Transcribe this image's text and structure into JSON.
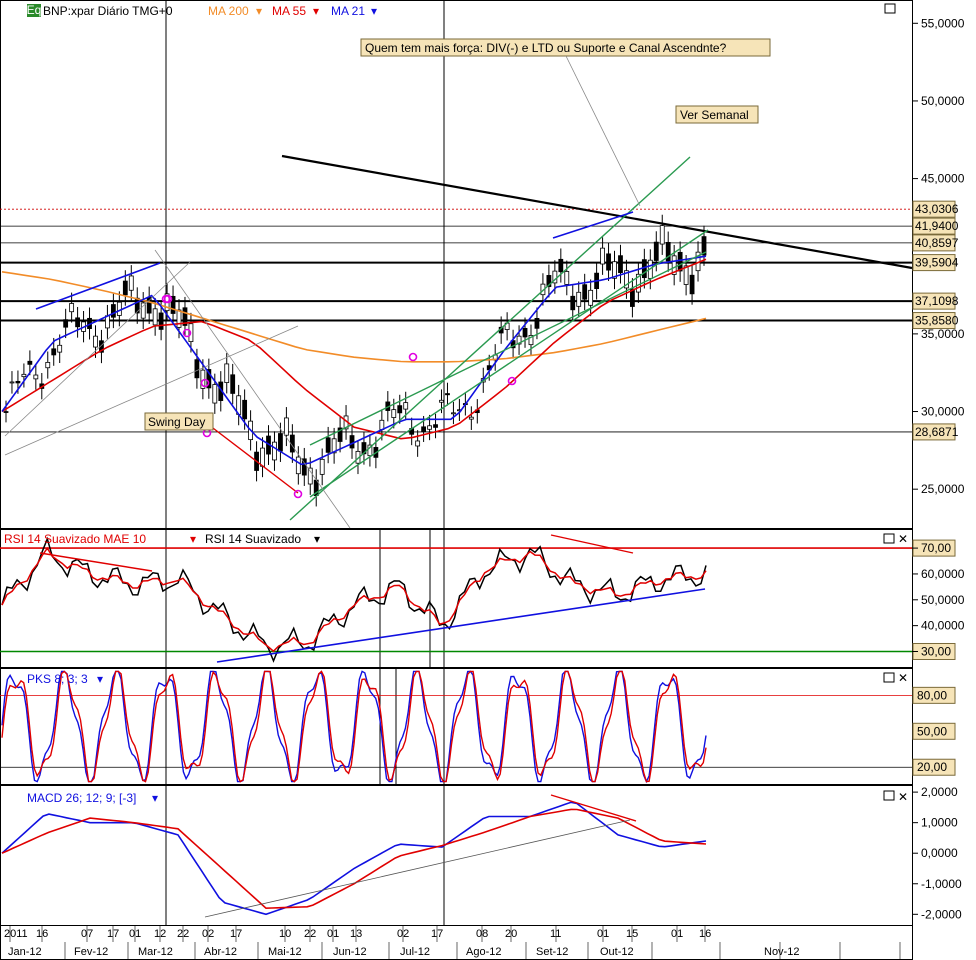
{
  "window": {
    "symbol_badge": "Eq",
    "symbol_title": "BNP:xpar Diário TMG+0",
    "ma_labels": [
      {
        "text": "MA 200",
        "color": "#f28c28"
      },
      {
        "text": "MA 55",
        "color": "#e00000"
      },
      {
        "text": "MA 21",
        "color": "#1010e0"
      }
    ]
  },
  "annotations": {
    "question": "Quem tem mais força: DIV(-) e LTD ou Suporte e Canal Ascendnte?",
    "weekly": "Ver Semanal",
    "swing_day": "Swing Day"
  },
  "panels": {
    "rsi": {
      "title_a": "RSI 14 Suavizado MAE 10",
      "title_b": "RSI 14 Suavizado",
      "color_a": "#e00000",
      "color_b": "#000000"
    },
    "pks": {
      "title": "PKS 8; 3; 3",
      "color": "#1010e0"
    },
    "macd": {
      "title": "MACD 26; 12; 9; [-3]",
      "color": "#1010e0"
    }
  },
  "chart_data": [
    {
      "type": "line",
      "title": "BNP:xpar Diário",
      "y_ticks": [
        "55,0000",
        "50,0000",
        "45,0000",
        "35,0000",
        "30,0000",
        "25,0000"
      ],
      "ylim": [
        22.5,
        56.5
      ],
      "price_levels": [
        "43,0306",
        "41,9400",
        "40,8597",
        "39,5904",
        "37,1098",
        "35,8580",
        "28,6871"
      ],
      "x_day_labels": [
        "2011",
        "16",
        "07",
        "17",
        "01",
        "12",
        "22",
        "02",
        "17",
        "10",
        "22",
        "01",
        "13",
        "02",
        "17",
        "08",
        "20",
        "11",
        "01",
        "15",
        "01",
        "16"
      ],
      "x_month_labels": [
        "Jan-12",
        "Fev-12",
        "Mar-12",
        "Abr-12",
        "Mai-12",
        "Jun-12",
        "Jul-12",
        "Ago-12",
        "Set-12",
        "Out-12",
        "Nov-12"
      ],
      "series": [
        {
          "name": "MA 200",
          "values": [
            39.0,
            38.5,
            37.8,
            37.0,
            36.0,
            35.0,
            34.0,
            33.5,
            33.2,
            33.2,
            33.4,
            33.8,
            34.4,
            35.2,
            36.0
          ]
        },
        {
          "name": "MA 55",
          "values": [
            30.0,
            32.0,
            34.0,
            35.5,
            35.8,
            34.5,
            31.5,
            29.0,
            28.2,
            29.0,
            31.5,
            34.5,
            37.0,
            38.5,
            39.8
          ]
        },
        {
          "name": "MA 21",
          "values": [
            30.0,
            34.5,
            36.0,
            37.5,
            33.0,
            28.5,
            26.5,
            28.0,
            29.5,
            29.5,
            34.0,
            38.0,
            38.5,
            39.5,
            40.0
          ]
        }
      ]
    },
    {
      "type": "line",
      "title": "RSI 14 Suavizado MAE 10",
      "y_ticks": [
        "70,00",
        "60,0000",
        "50,0000",
        "40,0000",
        "30,00"
      ],
      "ylim": [
        24,
        77
      ],
      "levels": [
        70,
        30
      ]
    },
    {
      "type": "line",
      "title": "PKS 8; 3; 3",
      "y_ticks": [
        "80,00",
        "50,00",
        "20,00"
      ],
      "ylim": [
        6,
        102
      ],
      "levels": [
        80,
        20
      ]
    },
    {
      "type": "line",
      "title": "MACD 26; 12; 9; [-3]",
      "y_ticks": [
        "2,0000",
        "1,0000",
        "0,0000",
        "-1,0000",
        "-2,0000"
      ],
      "ylim": [
        -2.35,
        2.2
      ]
    }
  ]
}
